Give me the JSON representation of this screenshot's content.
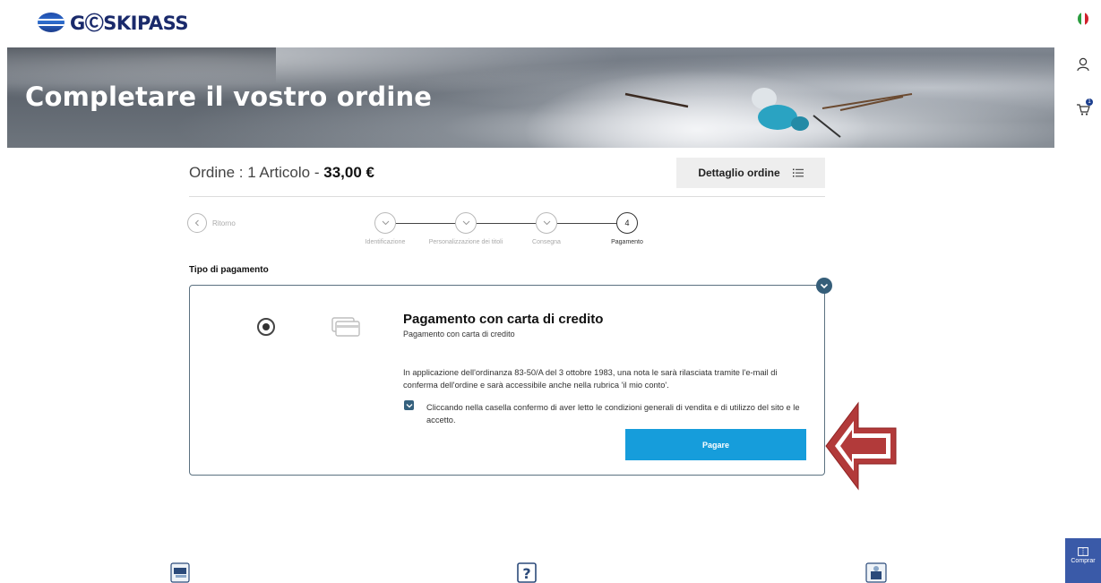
{
  "brand": {
    "logo_text": "GⒸSKIPASS"
  },
  "rail": {
    "cart_count": "1",
    "buy_label": "Comprar"
  },
  "hero": {
    "title": "Completare il vostro ordine"
  },
  "order": {
    "prefix": "Ordine : 1 Articolo - ",
    "total": "33,00 €",
    "detail_button": "Dettaglio ordine"
  },
  "steps": {
    "back_label": "Ritorno",
    "items": [
      {
        "label": "Identificazione",
        "state": "done"
      },
      {
        "label": "Personalizzazione dei titoli",
        "state": "done"
      },
      {
        "label": "Consegna",
        "state": "done"
      },
      {
        "label": "Pagamento",
        "state": "current",
        "number": "4"
      }
    ]
  },
  "payment": {
    "section_title": "Tipo di pagamento",
    "method_title": "Pagamento con carta di credito",
    "method_subtitle": "Pagamento con carta di credito",
    "note": "In applicazione dell'ordinanza 83-50/A del 3 ottobre 1983, una nota le sarà rilasciata tramite l'e-mail di conferma dell'ordine e sarà accessibile anche nella rubrica 'il mio conto'.",
    "terms": "Cliccando nella casella confermo di aver letto le condizioni generali di vendita e di utilizzo del sito e le accetto.",
    "terms_checked": true,
    "pay_button": "Pagare"
  },
  "colors": {
    "accent": "#169ddb",
    "brand": "#1a2a6b",
    "check": "#35617e",
    "arrow": "#b22222"
  },
  "icons": {
    "footer": [
      "card-hand-icon",
      "question-icon",
      "building-icon"
    ]
  }
}
